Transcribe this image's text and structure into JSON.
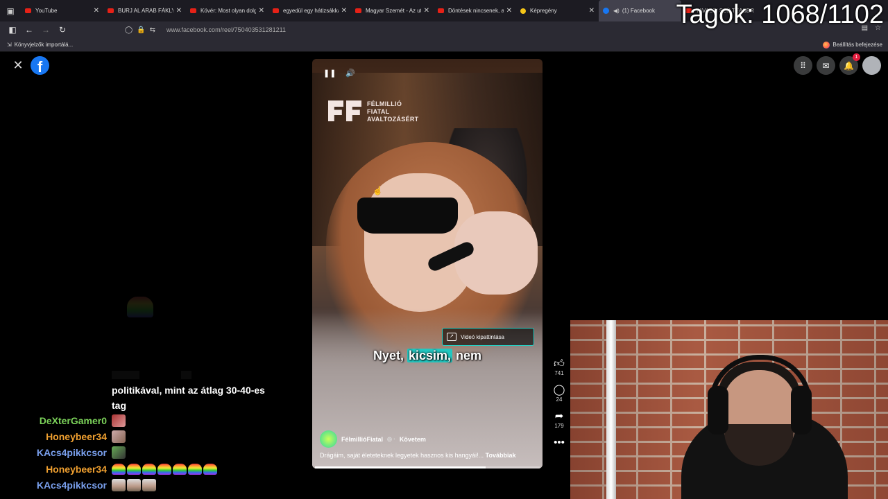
{
  "browser": {
    "tabs": [
      {
        "label": "YouTube",
        "icon": "youtube-icon",
        "active": false
      },
      {
        "label": "BURJ AL ARAB FÁKLYA",
        "icon": "youtube-icon",
        "active": false
      },
      {
        "label": "Kövér: Most olyan dolg",
        "icon": "youtube-icon",
        "active": false
      },
      {
        "label": "egyedül egy hátizsákka",
        "icon": "youtube-icon",
        "active": false
      },
      {
        "label": "Magyar Szemét - Az ut",
        "icon": "youtube-icon",
        "active": false
      },
      {
        "label": "Döntések nincsenek, a",
        "icon": "youtube-icon",
        "active": false
      },
      {
        "label": "Képregény",
        "icon": "wiki-icon",
        "active": false
      },
      {
        "label": "(1) Facebook",
        "icon": "facebook-icon",
        "active": true
      },
      {
        "label": "TAVASZI SZÜ TEASER",
        "icon": "youtube-icon",
        "active": false
      }
    ],
    "url": "www.facebook.com/reel/750403531281211",
    "bookmarks_left": "Könyvjelzők importálá...",
    "bookmarks_right": "Beállítás befejezése"
  },
  "overlay": {
    "counter": "Tagok: 1068/1102"
  },
  "facebook": {
    "notifications_count": "1",
    "reel": {
      "brand_line1": "FÉLMILLIÓ",
      "brand_line2": "FIATAL",
      "brand_line3": "AVALTOZÁSÉRT",
      "translate_label": "Videó kipattintása",
      "caption_prefix": "Nyet,",
      "caption_highlight": "kicsim,",
      "caption_suffix": "nem",
      "author": "FélmillióFiatal",
      "follow": "Követem",
      "description": "Drágáim, saját életeteknek legyetek hasznos kis hangyái!...",
      "more": "Továbbiak",
      "progress": 0.76
    },
    "actions": {
      "likes": "741",
      "comments": "24",
      "shares": "179"
    }
  },
  "chat": {
    "message_continuation_1": "politikával, mint az átlag 30-40-es",
    "message_continuation_2": "tag",
    "rows": [
      {
        "name": "DeXterGamer0",
        "color": "#7cd35a"
      },
      {
        "name": "Honeybeer34",
        "color": "#f0a030"
      },
      {
        "name": "KAcs4pikkcsor",
        "color": "#7aa0ee"
      },
      {
        "name": "Honeybeer34",
        "color": "#f0a030"
      },
      {
        "name": "KAcs4pikkcsor",
        "color": "#7aa0ee"
      }
    ]
  }
}
